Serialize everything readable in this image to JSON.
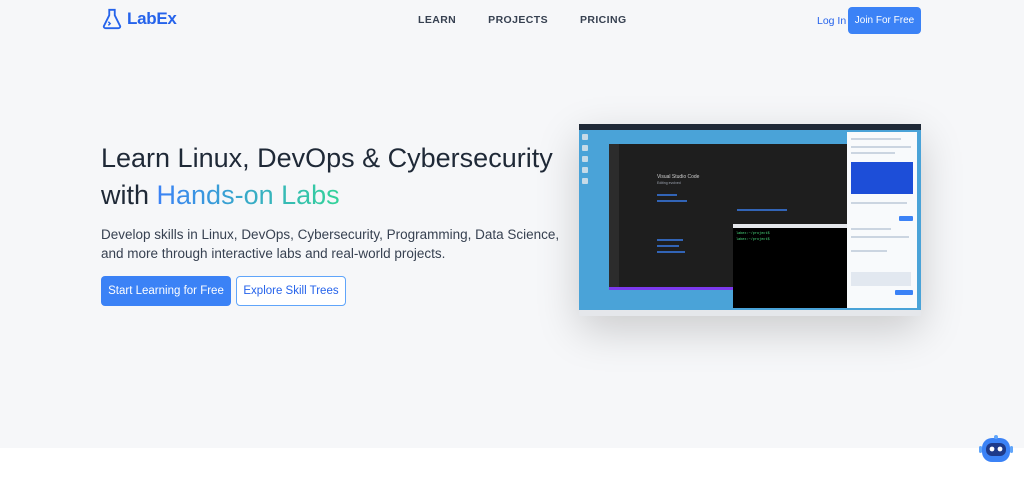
{
  "header": {
    "logo_text": "LabEx",
    "nav": [
      "LEARN",
      "PROJECTS",
      "PRICING"
    ],
    "login": "Log In",
    "join": "Join For Free"
  },
  "hero": {
    "title_line1": "Learn Linux, DevOps & Cybersecurity",
    "title_with": "with ",
    "title_accent": "Hands-on Labs",
    "subtitle": "Develop skills in Linux, DevOps, Cybersecurity, Programming, Data Science, and more through interactive labs and real-world projects.",
    "primary_button": "Start Learning for Free",
    "secondary_button": "Explore Skill Trees"
  },
  "mock": {
    "editor_title": "Visual Studio Code",
    "editor_subtitle": "Editing evolved",
    "terminal_line1": "labex:~/project$",
    "terminal_line2": "labex:~/project$ "
  },
  "colors": {
    "brand": "#2563eb",
    "button": "#3b82f6",
    "accent_gradient_end": "#34d399",
    "hero_background": "#f6f7f9"
  },
  "icons": {
    "logo": "flask-icon",
    "assistant": "robot-icon"
  }
}
